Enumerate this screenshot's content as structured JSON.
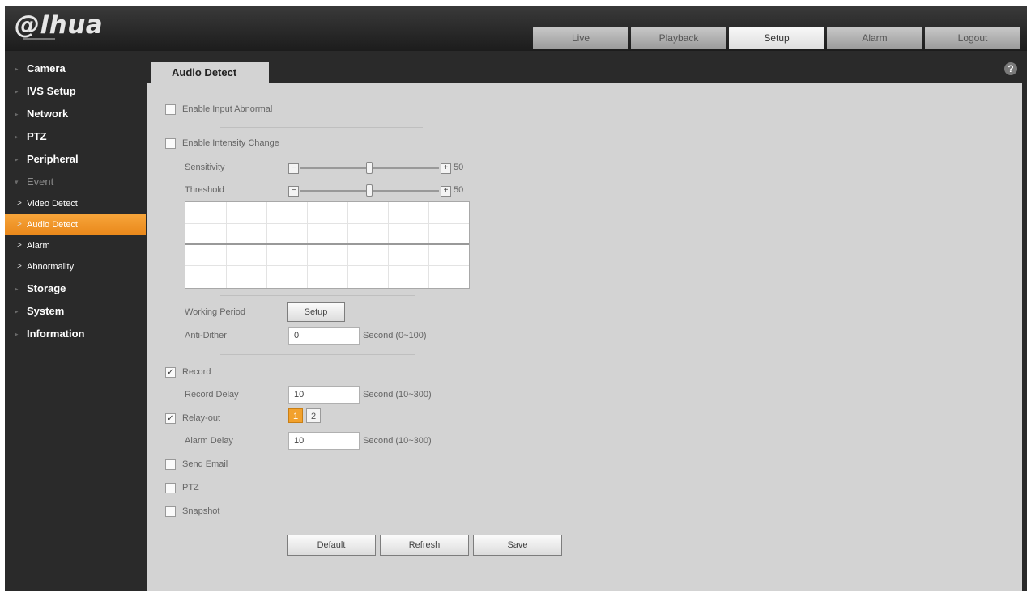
{
  "brand": {
    "logo_text": "@lhua"
  },
  "top_nav": [
    {
      "label": "Live"
    },
    {
      "label": "Playback"
    },
    {
      "label": "Setup",
      "active": true
    },
    {
      "label": "Alarm"
    },
    {
      "label": "Logout"
    }
  ],
  "sidebar": {
    "items": [
      {
        "label": "Camera"
      },
      {
        "label": "IVS Setup"
      },
      {
        "label": "Network"
      },
      {
        "label": "PTZ"
      },
      {
        "label": "Peripheral"
      },
      {
        "label": "Event",
        "expanded": true
      },
      {
        "label": "Storage"
      },
      {
        "label": "System"
      },
      {
        "label": "Information"
      }
    ],
    "event_sub": [
      {
        "label": "Video Detect"
      },
      {
        "label": "Audio Detect",
        "selected": true
      },
      {
        "label": "Alarm"
      },
      {
        "label": "Abnormality"
      }
    ]
  },
  "page": {
    "tab_title": "Audio Detect",
    "help_glyph": "?",
    "enable_input_abnormal": {
      "label": "Enable Input Abnormal",
      "checked": false
    },
    "enable_intensity_change": {
      "label": "Enable Intensity Change",
      "checked": false
    },
    "sensitivity": {
      "label": "Sensitivity",
      "value": "50",
      "fraction": 0.5
    },
    "threshold": {
      "label": "Threshold",
      "value": "50",
      "fraction": 0.5
    },
    "working_period": {
      "label": "Working Period",
      "button": "Setup"
    },
    "anti_dither": {
      "label": "Anti-Dither",
      "value": "0",
      "hint": "Second (0~100)"
    },
    "record": {
      "label": "Record",
      "checked": true
    },
    "record_delay": {
      "label": "Record Delay",
      "value": "10",
      "hint": "Second (10~300)"
    },
    "relay_out": {
      "label": "Relay-out",
      "checked": true,
      "channels": [
        "1",
        "2"
      ],
      "active_channel": "1"
    },
    "alarm_delay": {
      "label": "Alarm Delay",
      "value": "10",
      "hint": "Second (10~300)"
    },
    "send_email": {
      "label": "Send Email",
      "checked": false
    },
    "ptz": {
      "label": "PTZ",
      "checked": false
    },
    "snapshot": {
      "label": "Snapshot",
      "checked": false
    },
    "buttons": {
      "default": "Default",
      "refresh": "Refresh",
      "save": "Save"
    }
  },
  "colors": {
    "accent": "#ee8f20",
    "panel": "#d3d3d3",
    "chrome": "#2a2a2a"
  }
}
